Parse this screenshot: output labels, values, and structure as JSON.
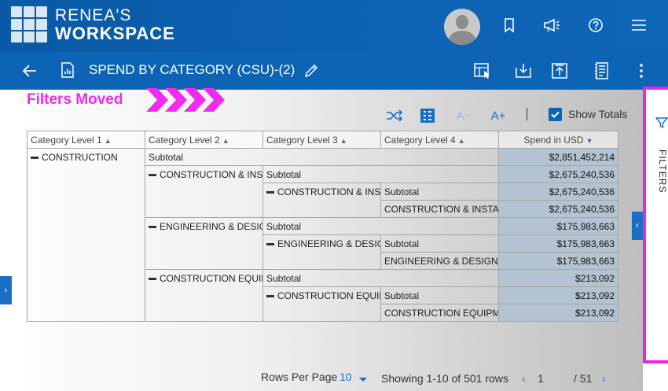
{
  "brand": {
    "line1": "RENEA'S",
    "line2": "WORKSPACE"
  },
  "header": {
    "icons": [
      "avatar",
      "bookmark-icon",
      "megaphone-icon",
      "help-icon",
      "hamburger-menu-icon"
    ]
  },
  "titlebar": {
    "title": "SPEND BY CATEGORY (CSU)-(2)",
    "icons": [
      "back-arrow-icon",
      "report-icon",
      "edit-pencil-icon",
      "drill-table-icon",
      "download-icon",
      "upload-icon",
      "notes-icon",
      "more-vertical-icon"
    ]
  },
  "annotation": {
    "text": "Filters Moved",
    "color": "#ee2bee"
  },
  "toolbar": {
    "font_decrease": "A−",
    "font_increase": "A+",
    "divider": "|",
    "show_totals_label": "Show Totals",
    "show_totals_checked": true
  },
  "table": {
    "columns": [
      "Category Level 1",
      "Category Level 2",
      "Category Level 3",
      "Category Level 4",
      "Spend in USD"
    ],
    "rows": {
      "r1": {
        "c1": "CONSTRUCTION",
        "c2": "Subtotal",
        "val": "$2,851,452,214"
      },
      "r2": {
        "c2": "CONSTRUCTION & INSTALLATION",
        "c3": "Subtotal",
        "val": "$2,675,240,536"
      },
      "r3": {
        "c3": "CONSTRUCTION & INSTALLATION",
        "c4": "Subtotal",
        "val": "$2,675,240,536"
      },
      "r4": {
        "c4": "CONSTRUCTION & INSTALLATION",
        "val": "$2,675,240,536"
      },
      "r5": {
        "c2": "ENGINEERING & DESIGN",
        "c3": "Subtotal",
        "val": "$175,983,663"
      },
      "r6": {
        "c3": "ENGINEERING & DESIGN",
        "c4": "Subtotal",
        "val": "$175,983,663"
      },
      "r7": {
        "c4": "ENGINEERING & DESIGN",
        "val": "$175,983,663"
      },
      "r8": {
        "c2": "CONSTRUCTION EQUIPMENT",
        "c3": "Subtotal",
        "val": "$213,092"
      },
      "r9": {
        "c3": "CONSTRUCTION EQUIPMENT",
        "c4": "Subtotal",
        "val": "$213,092"
      },
      "r10": {
        "c4": "CONSTRUCTION EQUIPMENT",
        "val": "$213,092"
      }
    }
  },
  "pagination": {
    "rows_per_page_label": "Rows Per Page",
    "rows_per_page_value": "10",
    "showing": "Showing 1-10 of 501 rows",
    "current_page": "1",
    "total_pages": "/ 51"
  },
  "filters_panel": {
    "label": "FILTERS",
    "border_color": "#e826e8"
  }
}
